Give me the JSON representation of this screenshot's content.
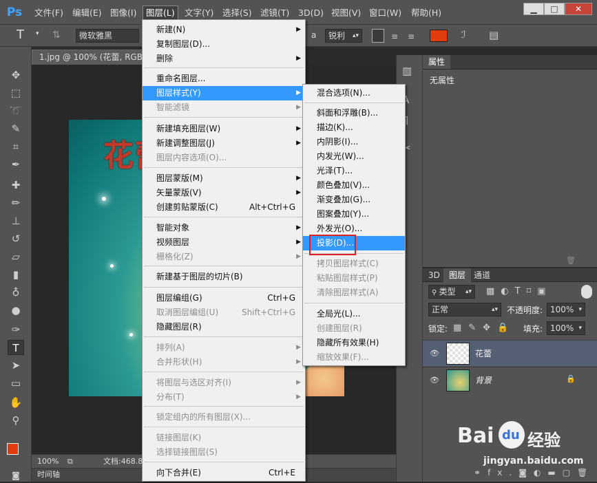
{
  "menubar": {
    "logo": "Ps",
    "items": [
      "文件(F)",
      "编辑(E)",
      "图像(I)",
      "图层(L)",
      "文字(Y)",
      "选择(S)",
      "滤镜(T)",
      "3D(D)",
      "视图(V)",
      "窗口(W)",
      "帮助(H)"
    ],
    "window_buttons": [
      "▁",
      "□",
      "✕"
    ]
  },
  "options": {
    "tool_glyph": "T",
    "font_family": "微软雅黑",
    "aa_prefix": "a",
    "antialias": "锐利",
    "color_swatch": "#e33b10"
  },
  "document": {
    "tab": "1.jpg @ 100% (花蕾, RGB/8",
    "art_text": "花蕾",
    "zoom": "100%",
    "doc_info": "文档:468.8",
    "timeline": "时间轴"
  },
  "properties": {
    "tab": "属性",
    "content": "无属性"
  },
  "layers": {
    "tabs": [
      "3D",
      "图层",
      "通道"
    ],
    "filter_label": "类型",
    "blend_mode": "正常",
    "opacity_label": "不透明度:",
    "opacity_value": "100%",
    "lock_label": "锁定:",
    "fill_label": "填充:",
    "fill_value": "100%",
    "rows": [
      {
        "name": "花蕾"
      },
      {
        "name": "背景"
      }
    ],
    "footer_icons": [
      "link-icon",
      "fx-icon",
      "mask-icon",
      "adjustment-icon",
      "group-icon",
      "new-layer-icon",
      "delete-icon"
    ],
    "fx_label": "fx."
  },
  "layer_menu": {
    "items": [
      {
        "label": "新建(N)",
        "arrow": true
      },
      {
        "label": "复制图层(D)..."
      },
      {
        "label": "删除",
        "arrow": true
      },
      {
        "label": "重命名图层..."
      },
      {
        "label": "图层样式(Y)",
        "arrow": true,
        "highlight": true
      },
      {
        "label": "智能滤镜",
        "arrow": true,
        "disabled": true
      },
      {
        "label": "新建填充图层(W)",
        "arrow": true
      },
      {
        "label": "新建调整图层(J)",
        "arrow": true
      },
      {
        "label": "图层内容选项(O)...",
        "disabled": true
      },
      {
        "label": "图层蒙版(M)",
        "arrow": true
      },
      {
        "label": "矢量蒙版(V)",
        "arrow": true
      },
      {
        "label": "创建剪贴蒙版(C)",
        "shortcut": "Alt+Ctrl+G"
      },
      {
        "label": "智能对象",
        "arrow": true
      },
      {
        "label": "视频图层",
        "arrow": true
      },
      {
        "label": "栅格化(Z)",
        "arrow": true,
        "disabled": true
      },
      {
        "label": "新建基于图层的切片(B)"
      },
      {
        "label": "图层编组(G)",
        "shortcut": "Ctrl+G"
      },
      {
        "label": "取消图层编组(U)",
        "shortcut": "Shift+Ctrl+G",
        "disabled": true
      },
      {
        "label": "隐藏图层(R)"
      },
      {
        "label": "排列(A)",
        "arrow": true,
        "disabled": true
      },
      {
        "label": "合并形状(H)",
        "arrow": true,
        "disabled": true
      },
      {
        "label": "将图层与选区对齐(I)",
        "arrow": true,
        "disabled": true
      },
      {
        "label": "分布(T)",
        "arrow": true,
        "disabled": true
      },
      {
        "label": "锁定组内的所有图层(X)...",
        "disabled": true
      },
      {
        "label": "链接图层(K)",
        "disabled": true
      },
      {
        "label": "选择链接图层(S)",
        "disabled": true
      },
      {
        "label": "向下合并(E)",
        "shortcut": "Ctrl+E"
      }
    ]
  },
  "style_submenu": {
    "items": [
      {
        "label": "混合选项(N)..."
      },
      {
        "label": "斜面和浮雕(B)..."
      },
      {
        "label": "描边(K)..."
      },
      {
        "label": "内阴影(I)..."
      },
      {
        "label": "内发光(W)..."
      },
      {
        "label": "光泽(T)..."
      },
      {
        "label": "颜色叠加(V)..."
      },
      {
        "label": "渐变叠加(G)..."
      },
      {
        "label": "图案叠加(Y)..."
      },
      {
        "label": "外发光(O)..."
      },
      {
        "label": "投影(D)...",
        "highlight": true
      },
      {
        "label": "拷贝图层样式(C)",
        "disabled": true
      },
      {
        "label": "粘贴图层样式(P)",
        "disabled": true
      },
      {
        "label": "清除图层样式(A)",
        "disabled": true
      },
      {
        "label": "全局光(L)..."
      },
      {
        "label": "创建图层(R)",
        "disabled": true
      },
      {
        "label": "隐藏所有效果(H)"
      },
      {
        "label": "缩放效果(F)...",
        "disabled": true
      }
    ]
  },
  "watermark": {
    "brand": "Bai",
    "paw": "du",
    "jingyan": "经验",
    "url": "jingyan.baidu.com"
  }
}
